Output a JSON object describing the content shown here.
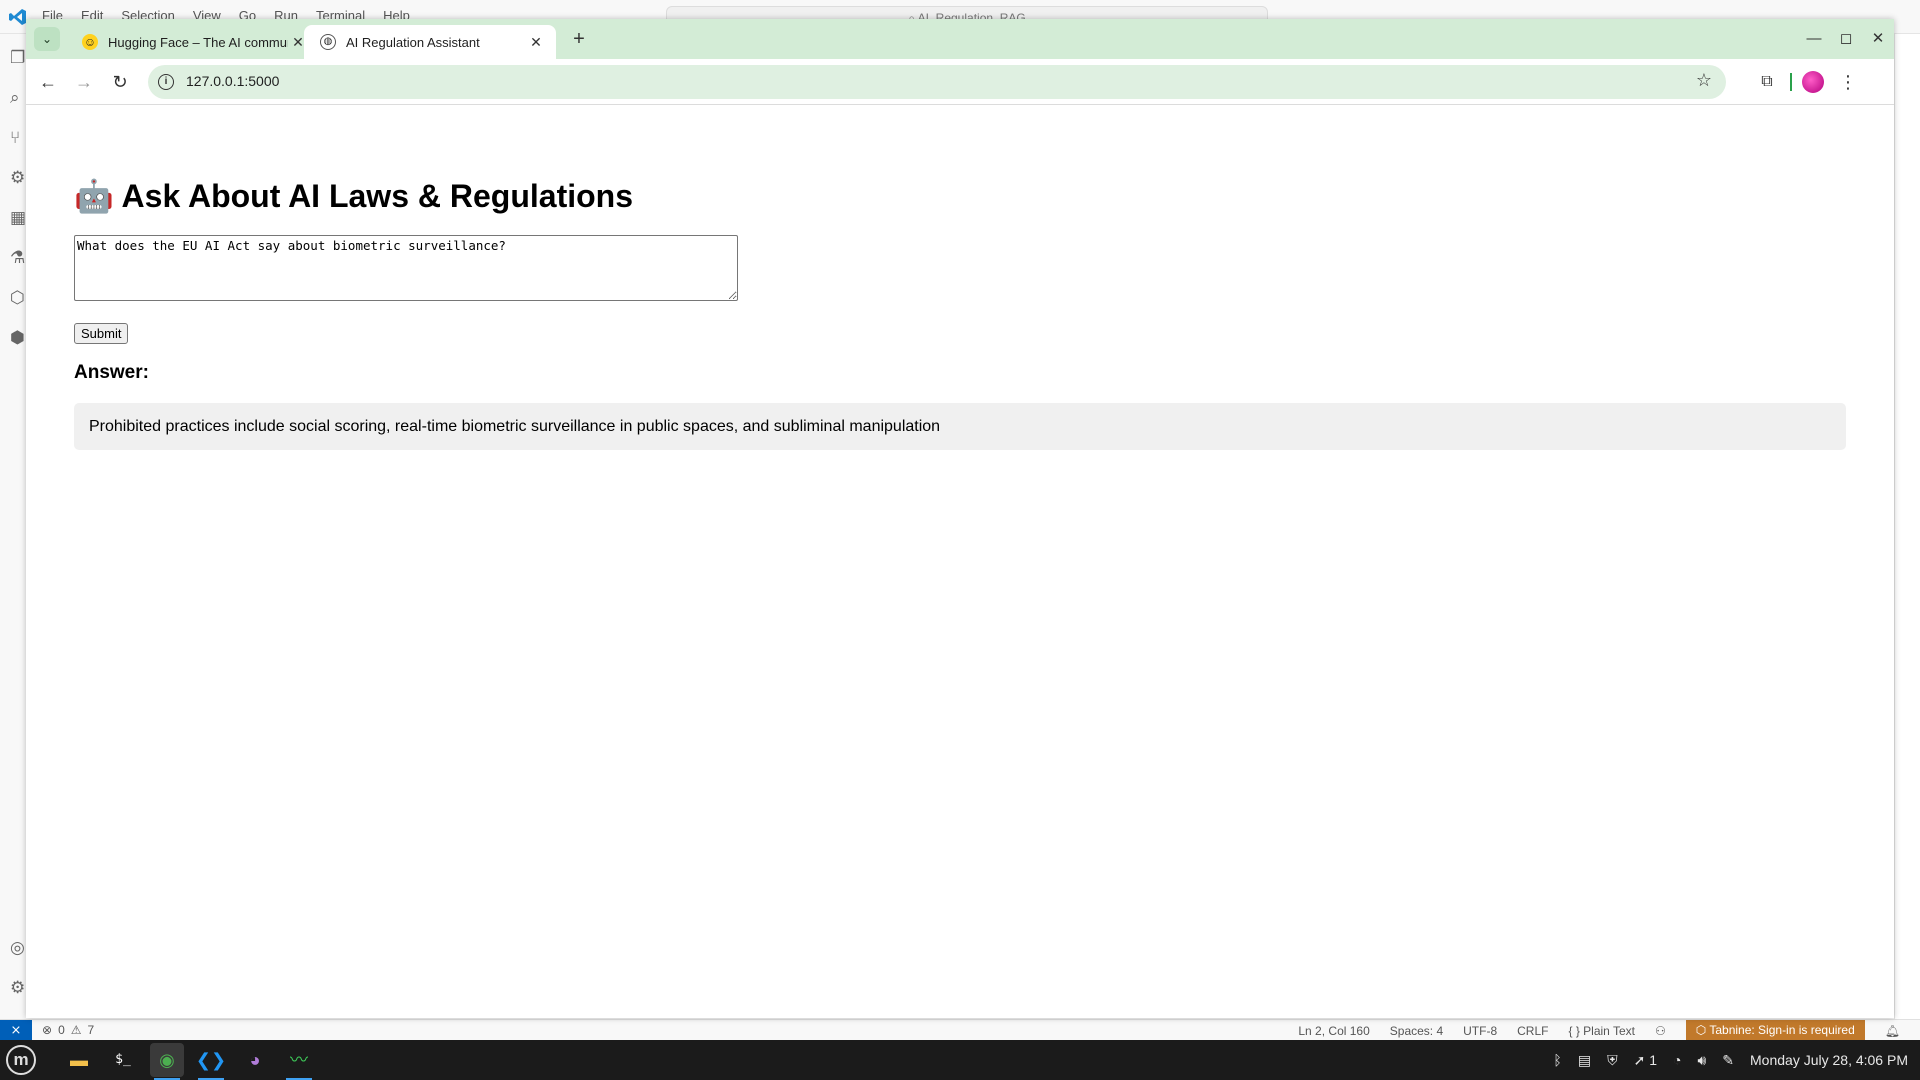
{
  "vscode": {
    "menu": [
      "File",
      "Edit",
      "Selection",
      "View",
      "Go",
      "Run",
      "Terminal",
      "Help"
    ],
    "command_center": "AI_Regulation_RAG",
    "status": {
      "errors": "0",
      "warnings": "7",
      "position": "Ln 2, Col 160",
      "spaces": "Spaces: 4",
      "encoding": "UTF-8",
      "eol": "CRLF",
      "language": "Plain Text",
      "tabnine": "Tabnine: Sign-in is required"
    }
  },
  "chrome": {
    "tabs": [
      {
        "title": "Hugging Face – The AI community",
        "favicon": "hugging-face-emoji"
      },
      {
        "title": "AI Regulation Assistant",
        "favicon": "globe-icon"
      }
    ],
    "url": "127.0.0.1:5000"
  },
  "page": {
    "title": "🤖 Ask About AI Laws & Regulations",
    "question": "What does the EU AI Act say about biometric surveillance?",
    "submit_label": "Submit",
    "answer_heading": "Answer:",
    "answer_text": "Prohibited practices include social scoring, real-time biometric surveillance in public spaces, and subliminal manipulation"
  },
  "taskbar": {
    "apps": [
      "files",
      "terminal",
      "chrome",
      "vscode",
      "github-desktop",
      "system-monitor"
    ],
    "tray_count": "1",
    "clock": "Monday July 28, 4:06 PM"
  },
  "colors": {
    "chrome_frame": "#d3ecd6",
    "omnibox": "#dff0e1",
    "answer_bg": "#f0f0f0",
    "vscode_remote": "#005fb8",
    "tabnine_bg": "#c1792b"
  }
}
